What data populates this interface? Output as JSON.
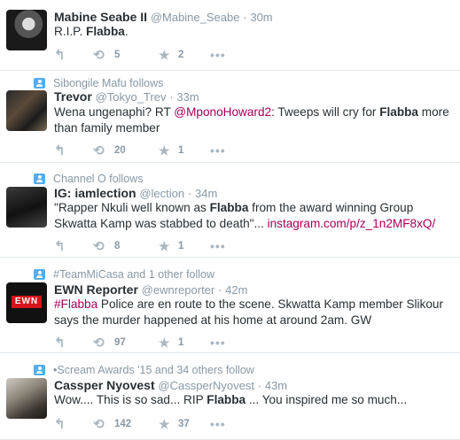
{
  "tweets": [
    {
      "social": null,
      "name": "Mabine Seabe II",
      "handle": "@Mabine_Seabe",
      "dot": "·",
      "time": "30m",
      "text_parts": [
        [
          "R.I.P. ",
          ""
        ],
        [
          "Flabba",
          "b"
        ],
        [
          ".",
          ""
        ]
      ],
      "retweets": "5",
      "favorites": "2",
      "avatar": "bw-portrait"
    },
    {
      "social": "Sibongile Mafu follows",
      "name": "Trevor",
      "handle": "@Tokyo_Trev",
      "dot": "·",
      "time": "33m",
      "text_parts": [
        [
          "Wena ungenaphi? RT ",
          ""
        ],
        [
          "@MponoHoward2",
          "link"
        ],
        [
          ": Tweeps will cry for ",
          ""
        ],
        [
          "Flabba",
          "b"
        ],
        [
          " more than family member",
          ""
        ]
      ],
      "retweets": "20",
      "favorites": "1",
      "avatar": "couple-photo"
    },
    {
      "social": "Channel O follows",
      "name": "IG: iamlection",
      "handle": "@lection",
      "dot": "·",
      "time": "34m",
      "text_parts": [
        [
          "\"Rapper Nkuli well known as ",
          ""
        ],
        [
          "Flabba",
          "b"
        ],
        [
          " from the award winning Group Skwatta Kamp was stabbed to death\"... ",
          ""
        ],
        [
          "instagram.com/p/z_1n2MF8xQ/",
          "link"
        ]
      ],
      "retweets": "8",
      "favorites": "1",
      "avatar": "dark-portrait"
    },
    {
      "social": "#TeamMiCasa and 1 other follow",
      "name": "EWN Reporter",
      "handle": "@ewnreporter",
      "dot": "·",
      "time": "42m",
      "text_parts": [
        [
          "#Flabba",
          "link"
        ],
        [
          " Police are en route to the scene. Skwatta Kamp member Slikour says the murder happened at his home at around 2am. GW",
          ""
        ]
      ],
      "retweets": "97",
      "favorites": "1",
      "avatar": "ewn-logo",
      "avatar_text": "EWN"
    },
    {
      "social": "•Scream Awards '15 and 34 others follow",
      "name": "Cassper Nyovest",
      "handle": "@CassperNyovest",
      "dot": "·",
      "time": "43m",
      "text_parts": [
        [
          "Wow.... This is so sad... RIP ",
          ""
        ],
        [
          "Flabba",
          "b"
        ],
        [
          " ... You inspired me so much...",
          ""
        ]
      ],
      "retweets": "142",
      "favorites": "37",
      "avatar": "cassper-photo"
    }
  ],
  "icons": {
    "reply": "reply-icon",
    "retweet": "retweet-icon",
    "favorite": "favorite-star-icon",
    "more": "more-dots-icon",
    "social": "person-follow-icon"
  },
  "colors": {
    "link": "#a5005a",
    "muted": "#8899a6",
    "icon": "#aab8c2",
    "social_icon": "#55acee",
    "divider": "#e1e8ed"
  },
  "glyphs": {
    "reply": "↰",
    "retweet": "⟲",
    "favorite": "★",
    "more": "•••"
  }
}
